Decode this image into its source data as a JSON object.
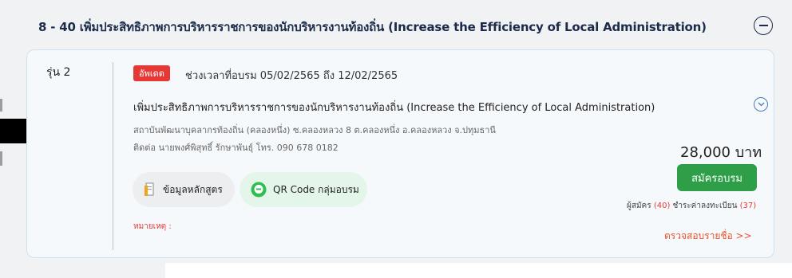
{
  "header": {
    "title": "8 - 40 เพิ่มประสิทธิภาพการบริหารราชการของนักบริหารงานท้องถิ่น (Increase the Efficiency of Local Administration)",
    "collapse_icon": "minus-circle-icon"
  },
  "card": {
    "round_label": "รุ่น 2",
    "badge": "อัพเดต",
    "period": "ช่วงเวลาที่อบรม 05/02/2565 ถึง 12/02/2565",
    "course_name": "เพิ่มประสิทธิภาพการบริหารราชการของนักบริหารงานท้องถิ่น (Increase the Efficiency of Local Administration)",
    "address": "สถาบันพัฒนาบุคลากรท้องถิ่น (คลองหนึ่ง) ซ.คลองหลวง 8 ต.คลองหนึ่ง อ.คลองหลวง จ.ปทุมธานี",
    "contact": "ติดต่อ นายพงศ์พิสุทธิ์ รักษาพันธุ์ โทร. 090 678 0182",
    "price": "28,000 บาท",
    "detail_button": "ข้อมูลหลักสูตร",
    "qr_button": "QR Code กลุ่มอบรม",
    "register_button": "สมัครอบรม",
    "applicants_label": "ผู้สมัคร",
    "applicants_count": "(40)",
    "paid_label": "ชำระค่าลงทะเบียน",
    "paid_count": "(37)",
    "note_label": "หมายเหตุ :",
    "check_list_link": "ตรวจสอบรายชื่อ >>",
    "colors": {
      "badge": "#e53935",
      "register": "#2e9e48",
      "link": "#e8542b"
    }
  }
}
